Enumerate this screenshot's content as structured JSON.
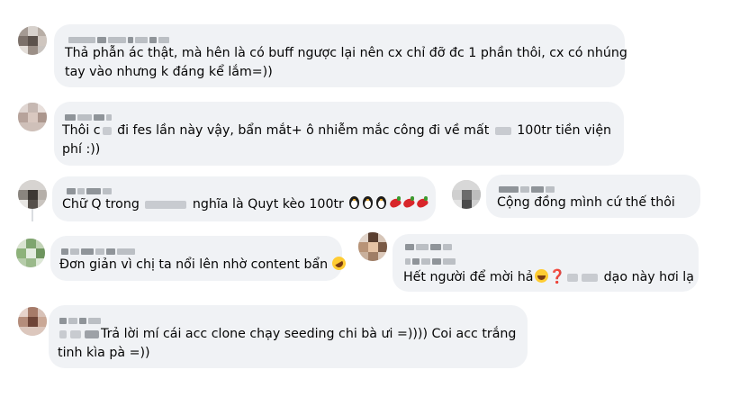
{
  "comments": [
    {
      "author": "",
      "lines": [
        "Thả phẫn ác thật, mà hên là có buff ngược lại nên cx chỉ đỡ đc 1 phần thôi, cx có nhúng",
        "tay vào nhưng k đáng kể lắm=))"
      ]
    },
    {
      "author": "",
      "line1_a": "Thôi c",
      "line1_b": " đi fes lần này vậy, bẩn mắt+ ô nhiễm mắc công đi về mất ",
      "line1_c": " 100tr tiền viện",
      "line2": "phí :))"
    },
    {
      "author": "",
      "text_a": "Chữ Q trong ",
      "text_b": " nghĩa là Quyt kèo 100tr ",
      "emojis": [
        "penguin-icon",
        "penguin-icon",
        "penguin-icon",
        "chili-pepper-icon",
        "chili-pepper-icon",
        "chili-pepper-icon"
      ]
    },
    {
      "author": "",
      "text": "Cộng đồng mình cứ thế thôi"
    },
    {
      "author": "",
      "text": "Đơn giản vì chị ta nổi lên nhờ content bẩn ",
      "emoji": "rolling-on-floor-laughing-icon"
    },
    {
      "author": "",
      "text_a": "Hết người để mời hả",
      "text_b": " dạo này hơi lạ",
      "emojis": [
        "grinning-face-icon",
        "red-question-mark-icon"
      ],
      "question_mark": "❓"
    },
    {
      "author": "",
      "line1": "Trả lời mí cái acc clone chạy seeding chi bà ưi =)))) Coi acc trắng",
      "line2": "tinh kìa pà =))"
    }
  ],
  "colors": {
    "bubble_bg": "#f0f2f5",
    "text": "#050505",
    "thread_line": "#dadde1",
    "page_bg": "#ffffff"
  }
}
